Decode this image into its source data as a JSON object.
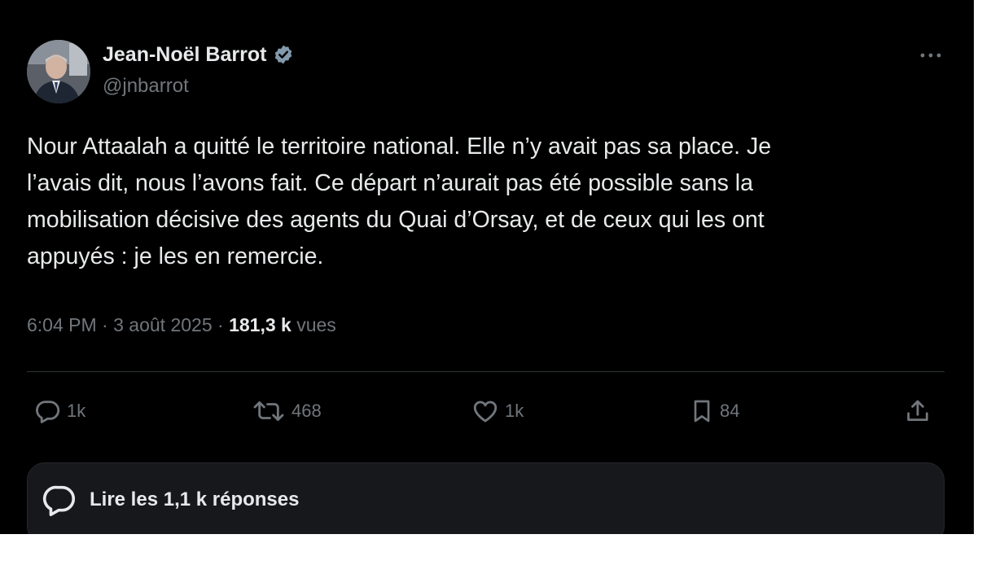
{
  "author": {
    "display_name": "Jean-Noël Barrot",
    "handle": "@jnbarrot",
    "verified": true,
    "verified_badge_color": "#829aab"
  },
  "tweet": {
    "lines": [
      "Nour Attaalah a quitté le territoire national. Elle n’y avait pas sa place. Je",
      "l’avais dit, nous l’avons fait. Ce départ n’aurait pas été possible sans la",
      "mobilisation décisive des agents du Quai d’Orsay, et de ceux qui les ont",
      "appuyés : je les en remercie."
    ],
    "time": "6:04 PM",
    "separator": "·",
    "date": "3 août 2025",
    "views_count": "181,3 k",
    "views_label": "vues"
  },
  "actions": {
    "replies": "1k",
    "reposts": "468",
    "likes": "1k",
    "bookmarks": "84"
  },
  "read_replies": {
    "label": "Lire les 1,1 k réponses"
  },
  "icons": {
    "more": "more-horizontal-icon",
    "reply": "speech-bubble-icon",
    "repost": "repost-arrows-icon",
    "like": "heart-icon",
    "bookmark": "bookmark-icon",
    "share": "share-upload-icon"
  },
  "colors": {
    "background": "#000000",
    "text_primary": "#e7e9ea",
    "text_secondary": "#71767b",
    "divider": "#2f3336",
    "reply_box": "#16181c"
  }
}
